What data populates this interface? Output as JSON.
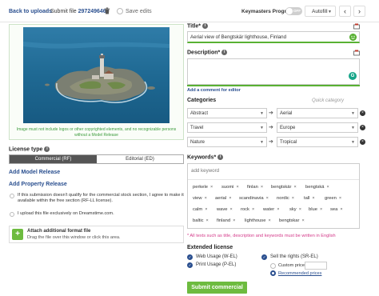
{
  "topbar": {
    "back_label": "Back to uploads",
    "separator": "›",
    "submit_file_prefix": "Submit file",
    "file_id": "297249646",
    "save_edits_label": "Save edits",
    "keymasters_label": "Keymasters Program",
    "toggle_state": "OFF",
    "autofill_label": "Autofill",
    "prev_label": "‹",
    "next_label": "›"
  },
  "image_panel": {
    "note": "Image must not include logos or other copyrighted elements, and no recognizable persons without a Model Release"
  },
  "license": {
    "label": "License type",
    "options": [
      "Commercial (RF)",
      "Editorial (ED)"
    ],
    "selected": "Commercial (RF)"
  },
  "links": {
    "add_model_release": "Add Model Release",
    "add_property_release": "Add Property Release"
  },
  "options": {
    "commercial_stock_note": "If this submission doesn't qualify for the commercial stock section, I agree to make it available within the free section (RF-LL license).",
    "exclusive_note": "I upload this file exclusively on Dreamstime.com."
  },
  "attach": {
    "title": "Attach additional format file",
    "hint": "Drag the file over this window or click this area."
  },
  "title_field": {
    "label": "Title*",
    "value": "Aerial view of Bengtskär lighthouse, Finland"
  },
  "description_field": {
    "label": "Description*",
    "value": "",
    "add_comment_label": "Add a comment for editor"
  },
  "categories": {
    "label": "Categories",
    "quick_label": "Quick category",
    "rows": [
      {
        "left": "Abstract",
        "right": "Aerial"
      },
      {
        "left": "Travel",
        "right": "Europe"
      },
      {
        "left": "Nature",
        "right": "Tropical"
      }
    ]
  },
  "keywords": {
    "label": "Keywords*",
    "placeholder": "add keyword",
    "tags": [
      [
        "perkele",
        "suomi",
        "finlan",
        "bengtskär",
        "bengtskä"
      ],
      [
        "view",
        "aerial",
        "scandinavia",
        "nordic",
        "tall",
        "green"
      ],
      [
        "calm",
        "wave",
        "rock",
        "water",
        "sky",
        "blue",
        "sea"
      ],
      [
        "baltic",
        "finland",
        "lighthouse",
        "bengtskar"
      ]
    ]
  },
  "warning": "* All texts such as title, description and keywords must be written in English",
  "extended_license": {
    "label": "Extended license",
    "web_usage": "Web Usage (W-EL)",
    "print_usage": "Print Usage (P-EL)",
    "sell_rights": "Sell the rights (SR-EL)",
    "custom_price": "Custom price:",
    "recommended": "Recommended prices"
  },
  "submit_label": "Submit commercial",
  "colors": {
    "link_blue": "#2a4f8f",
    "accent_green": "#6dbb3f",
    "warning_pink": "#d43a8a",
    "selected_dark": "#555555"
  }
}
